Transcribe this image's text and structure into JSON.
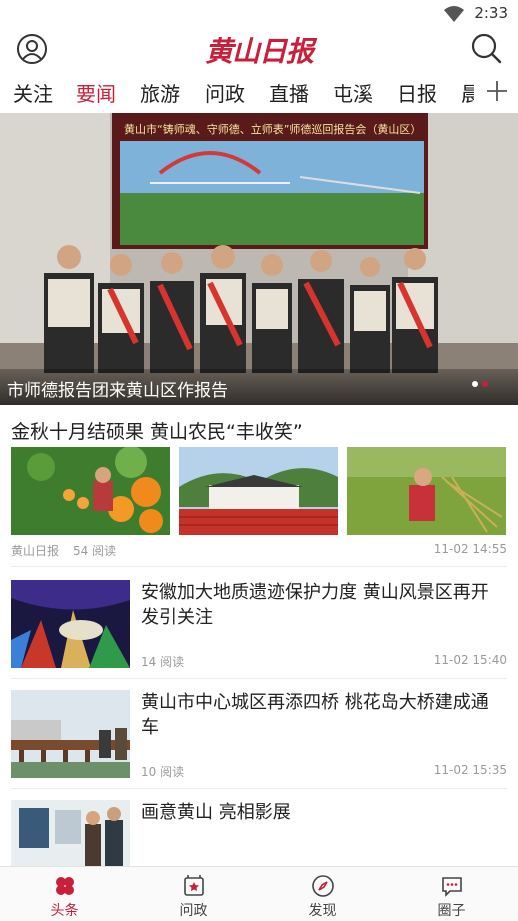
{
  "status_bar": {
    "time": "2:33",
    "wifi_icon": "wifi-icon"
  },
  "header": {
    "logo_text": "黄山日报",
    "avatar_icon": "user-icon",
    "search_icon": "search-icon",
    "accent": "#c8203a"
  },
  "tabs": {
    "items": [
      {
        "label": "关注"
      },
      {
        "label": "要闻",
        "active": true
      },
      {
        "label": "旅游"
      },
      {
        "label": "问政"
      },
      {
        "label": "直播"
      },
      {
        "label": "屯溪"
      },
      {
        "label": "日报"
      },
      {
        "label": "晨"
      }
    ],
    "add_icon": "plus-icon"
  },
  "hero": {
    "banner_text": "黄山市“铸师魂、守师德、立师表”师德巡回报告会（黄山区）",
    "caption": "市师德报告团来黄山区作报告",
    "slides": 2,
    "active_slide": 2
  },
  "articles": [
    {
      "title": "金秋十月结硕果 黄山农民“丰收笑”",
      "source": "黄山日报",
      "reads": "54 阅读",
      "time": "11-02 14:55"
    },
    {
      "title": "安徽加大地质遗迹保护力度 黄山风景区再开发引关注",
      "reads": "14 阅读",
      "time": "11-02 15:40"
    },
    {
      "title": "黄山市中心城区再添四桥 桃花岛大桥建成通车",
      "reads": "10 阅读",
      "time": "11-02 15:35"
    },
    {
      "title": "画意黄山 亮相影展"
    }
  ],
  "bottom_nav": [
    {
      "label": "头条",
      "icon": "headlines-icon",
      "active": true
    },
    {
      "label": "问政",
      "icon": "inbox-icon"
    },
    {
      "label": "发现",
      "icon": "compass-icon"
    },
    {
      "label": "圈子",
      "icon": "chat-icon"
    }
  ]
}
